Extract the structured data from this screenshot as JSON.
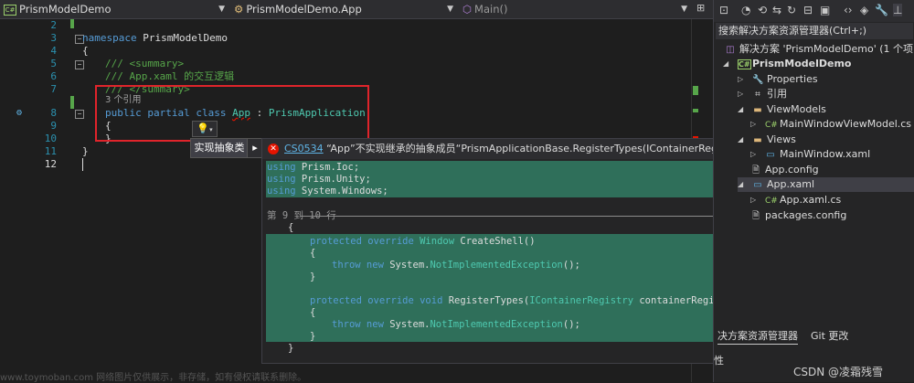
{
  "navbar": {
    "project_combo": "PrismModelDemo",
    "class_combo": "PrismModelDemo.App",
    "member_combo": "Main()"
  },
  "editor": {
    "lines": [
      {
        "num": "2"
      },
      {
        "num": "3"
      },
      {
        "num": "4"
      },
      {
        "num": "5"
      },
      {
        "num": "6"
      },
      {
        "num": "7"
      },
      {
        "num": "8"
      },
      {
        "num": "9"
      },
      {
        "num": "10"
      },
      {
        "num": "11"
      },
      {
        "num": "12"
      }
    ],
    "code": {
      "namespace_kw": "namespace",
      "namespace_name": " PrismModelDemo",
      "brace_open": "{",
      "summary_open": "/// <summary>",
      "summary_text": "/// App.xaml 的交互逻辑",
      "summary_close": "/// </summary>",
      "references": "3 个引用",
      "class_mods": "public partial class ",
      "class_name": "App",
      "class_colon": " : ",
      "base_class": "PrismApplication",
      "inner_open": "{",
      "inner_close": "}",
      "ns_close": "}"
    }
  },
  "quick_action": {
    "menu_item": "实现抽象类",
    "arrow": "▸"
  },
  "preview": {
    "error_code": "CS0534",
    "error_message": "“App”不实现继承的抽象成员“PrismApplicationBase.RegisterTypes(IContainerRegistry)”",
    "usings": [
      {
        "kw": "using",
        "ns": " Prism.Ioc;"
      },
      {
        "kw": "using",
        "ns": " Prism.Unity;"
      },
      {
        "kw": "using",
        "ns": " System.Windows;"
      }
    ],
    "range_label": "第 9 到 10 行",
    "open_brace": "{",
    "m1_kw": "protected override ",
    "m1_type": "Window",
    "m1_name": " CreateShell()",
    "b1": "{",
    "throw1_kw": "throw new ",
    "throw1_ns": "System.",
    "throw1_exc": "NotImplementedException",
    "throw1_end": "();",
    "b2": "}",
    "m2_kw": "protected override void ",
    "m2_name": "RegisterTypes(",
    "m2_ptype": "IContainerRegistry",
    "m2_param": " containerRegistry)",
    "b3": "{",
    "throw2_kw": "throw new ",
    "throw2_ns": "System.",
    "throw2_exc": "NotImplementedException",
    "throw2_end": "();",
    "b4": "}",
    "close_brace": "}"
  },
  "solution_explorer": {
    "search_placeholder": "搜索解决方案资源管理器(Ctrl+;)",
    "nodes": [
      {
        "label": "解决方案 'PrismModelDemo' (1 个项目,",
        "icon": "solution-icon"
      },
      {
        "label": "PrismModelDemo",
        "icon": "csharp-project-icon"
      },
      {
        "label": "Properties",
        "icon": "wrench-icon"
      },
      {
        "label": "引用",
        "icon": "references-icon"
      },
      {
        "label": "ViewModels",
        "icon": "folder-icon"
      },
      {
        "label": "MainWindowViewModel.cs",
        "icon": "csharp-file-icon"
      },
      {
        "label": "Views",
        "icon": "folder-icon"
      },
      {
        "label": "MainWindow.xaml",
        "icon": "xaml-icon"
      },
      {
        "label": "App.config",
        "icon": "config-icon"
      },
      {
        "label": "App.xaml",
        "icon": "xaml-icon"
      },
      {
        "label": "App.xaml.cs",
        "icon": "csharp-file-icon"
      },
      {
        "label": "packages.config",
        "icon": "config-icon"
      }
    ],
    "tabs": [
      "决方案资源管理器",
      "Git 更改"
    ],
    "properties_label": "性"
  },
  "watermark": "CSDN @凌霜残雪",
  "watermark_site": "www.toymoban.com 网络图片仅供展示，非存储，如有侵权请联系删除。"
}
